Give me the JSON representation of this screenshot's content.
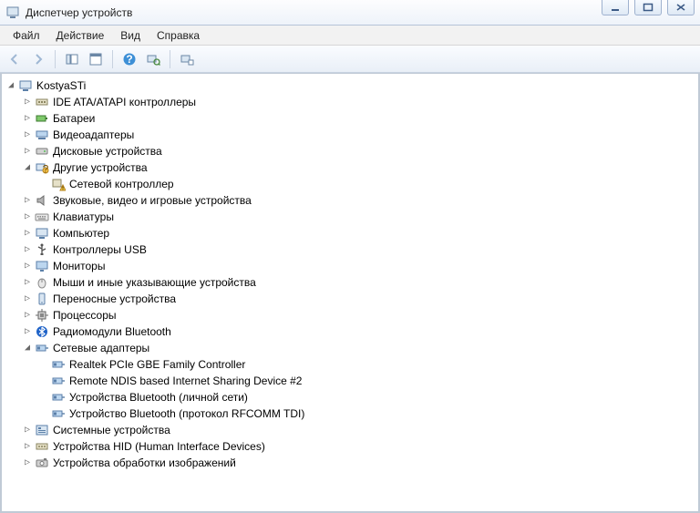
{
  "title": "Диспетчер устройств",
  "menubar": {
    "file": "Файл",
    "action": "Действие",
    "view": "Вид",
    "help": "Справка"
  },
  "tree": {
    "root": "KostyaSTi",
    "cat": {
      "ide": "IDE ATA/ATAPI контроллеры",
      "batteries": "Батареи",
      "display": "Видеоадаптеры",
      "disk": "Дисковые устройства",
      "other": "Другие устройства",
      "other_children": {
        "netctrl": "Сетевой контроллер"
      },
      "audio": "Звуковые, видео и игровые устройства",
      "keyboard": "Клавиатуры",
      "computer": "Компьютер",
      "usb": "Контроллеры USB",
      "monitor": "Мониторы",
      "mouse": "Мыши и иные указывающие устройства",
      "portable": "Переносные устройства",
      "cpu": "Процессоры",
      "bluetooth": "Радиомодули Bluetooth",
      "netadapters": "Сетевые адаптеры",
      "netadapters_children": {
        "n1": "Realtek PCIe GBE Family Controller",
        "n2": "Remote NDIS based Internet Sharing Device #2",
        "n3": "Устройства Bluetooth (личной сети)",
        "n4": "Устройство Bluetooth (протокол RFCOMM TDI)"
      },
      "system": "Системные устройства",
      "hid": "Устройства HID (Human Interface Devices)",
      "imaging": "Устройства обработки изображений"
    }
  }
}
